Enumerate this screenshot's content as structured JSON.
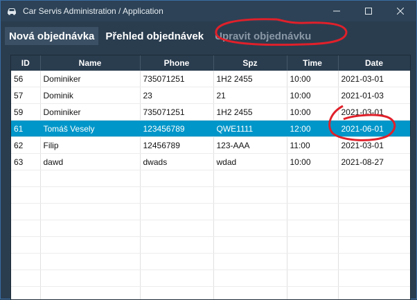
{
  "window": {
    "title": "Car Servis Administration / Application",
    "icon": "car-icon",
    "minimize_glyph": "—",
    "maximize_glyph": "☐",
    "close_glyph": "✕"
  },
  "tabs": [
    {
      "label": "Nová objednávka",
      "state": "active"
    },
    {
      "label": "Přehled objednávek",
      "state": "normal"
    },
    {
      "label": "Upravit objednávku",
      "state": "disabled"
    }
  ],
  "table": {
    "columns": [
      "ID",
      "Name",
      "Phone",
      "Spz",
      "Time",
      "Date"
    ],
    "rows": [
      {
        "id": "56",
        "name": "Dominiker",
        "phone": "735071251",
        "spz": "1H2 2455",
        "time": "10:00",
        "date": "2021-03-01",
        "selected": false
      },
      {
        "id": "57",
        "name": "Dominik",
        "phone": "23",
        "spz": "21",
        "time": "10:00",
        "date": "2021-01-03",
        "selected": false
      },
      {
        "id": "59",
        "name": "Dominiker",
        "phone": "735071251",
        "spz": "1H2 2455",
        "time": "10:00",
        "date": "2021-03-01",
        "selected": false
      },
      {
        "id": "61",
        "name": "Tomáš Vesely",
        "phone": "123456789",
        "spz": "QWE1111",
        "time": "12:00",
        "date": "2021-06-01",
        "selected": true
      },
      {
        "id": "62",
        "name": "Filip",
        "phone": "12456789",
        "spz": "123-AAA",
        "time": "11:00",
        "date": "2021-03-01",
        "selected": false
      },
      {
        "id": "63",
        "name": "dawd",
        "phone": "dwads",
        "spz": "wdad",
        "time": "10:00",
        "date": "2021-08-27",
        "selected": false
      }
    ],
    "selected_color": "#0096c9"
  },
  "colors": {
    "window_bg": "#2a3d4f",
    "annotation": "#e0202a"
  }
}
